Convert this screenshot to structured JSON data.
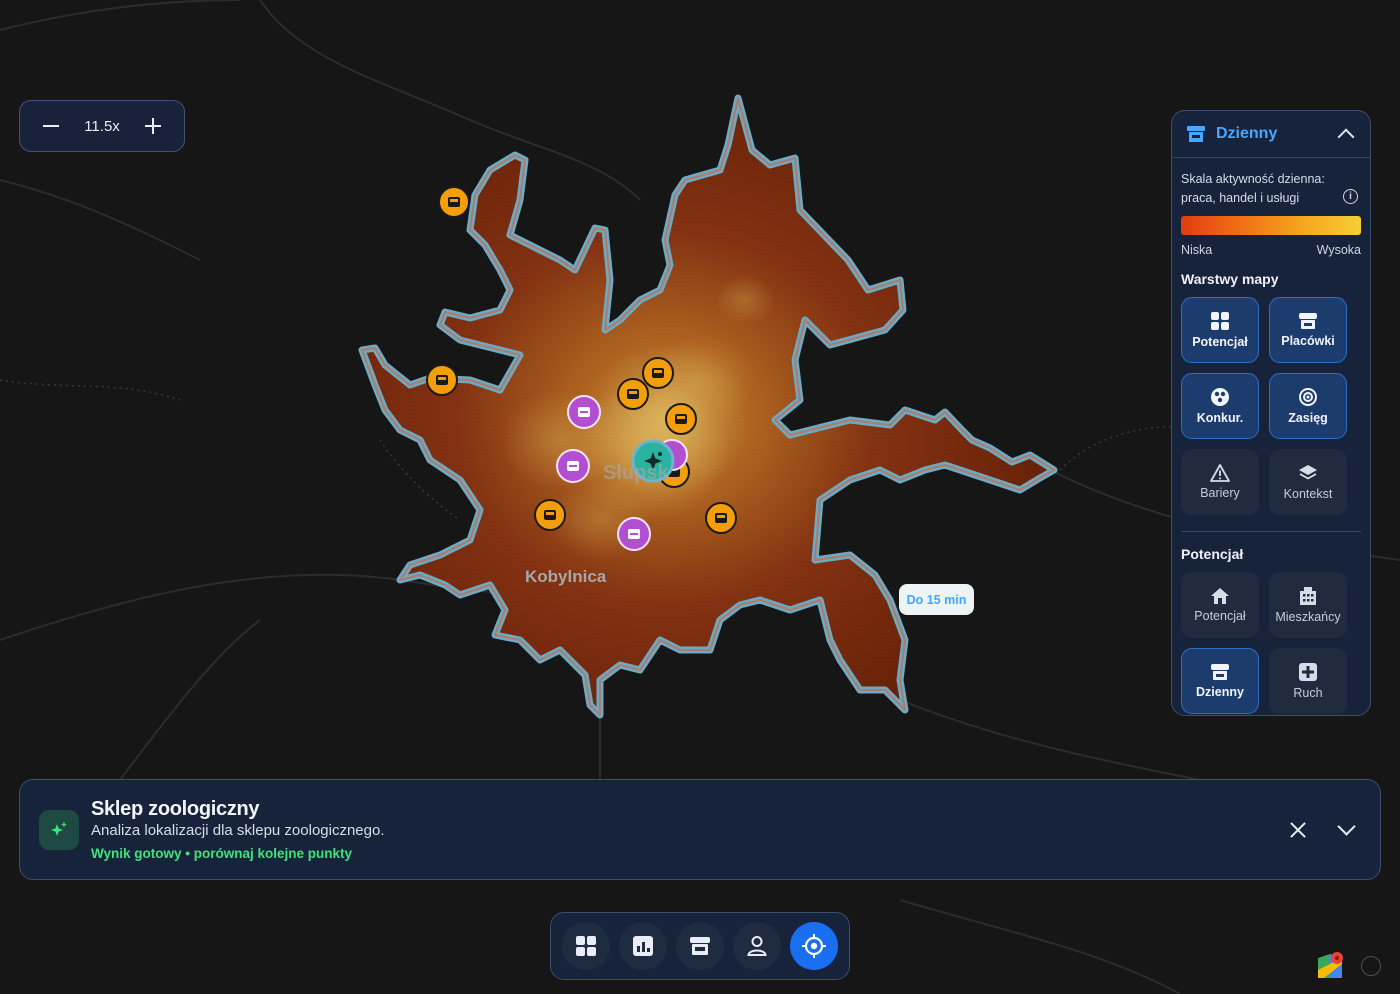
{
  "map": {
    "places": {
      "main_city": "Słupsk",
      "town": "Kobylnica"
    },
    "isochrone_label": "Do 15 min",
    "heat_colors": {
      "low": "#b23f0a",
      "high": "#f6c93a",
      "outline": "#7bb3cc"
    },
    "markers": {
      "orange": "#f59e0b",
      "purple": "#b44ed1",
      "selected": "#2ab3a0"
    }
  },
  "zoom": {
    "level": "11.5x",
    "minus_icon": "minus-icon",
    "plus_icon": "plus-icon"
  },
  "panel": {
    "title": "Dzienny",
    "description": "Skala aktywność dzienna: praca, handel i usługi",
    "scale_low": "Niska",
    "scale_high": "Wysoka",
    "layers_title": "Warstwy mapy",
    "layers": [
      {
        "label": "Potencjał",
        "icon": "grid-icon",
        "active": true
      },
      {
        "label": "Placówki",
        "icon": "store-icon",
        "active": true
      },
      {
        "label": "Konkur.",
        "icon": "competition-icon",
        "active": true
      },
      {
        "label": "Zasięg",
        "icon": "range-icon",
        "active": true
      },
      {
        "label": "Bariery",
        "icon": "warning-icon",
        "active": false
      },
      {
        "label": "Kontekst",
        "icon": "layers-icon",
        "active": false
      }
    ],
    "potential_title": "Potencjał",
    "potential": [
      {
        "label": "Potencjał",
        "icon": "home-icon",
        "active": false
      },
      {
        "label": "Mieszkańcy",
        "icon": "buildings-icon",
        "active": false
      },
      {
        "label": "Dzienny",
        "icon": "store-icon",
        "active": true
      },
      {
        "label": "Ruch",
        "icon": "traffic-icon",
        "active": false
      }
    ]
  },
  "info_card": {
    "title": "Sklep zoologiczny",
    "subtitle": "Analiza lokalizacji dla sklepu zoologicznego.",
    "status": "Wynik gotowy • porównaj kolejne punkty",
    "status_color": "#3ee37b"
  },
  "toolbar": {
    "buttons": [
      {
        "icon": "grid-icon",
        "active": false
      },
      {
        "icon": "chart-icon",
        "active": false
      },
      {
        "icon": "store-icon",
        "active": false
      },
      {
        "icon": "person-icon",
        "active": false
      },
      {
        "icon": "target-icon",
        "active": true
      }
    ]
  }
}
